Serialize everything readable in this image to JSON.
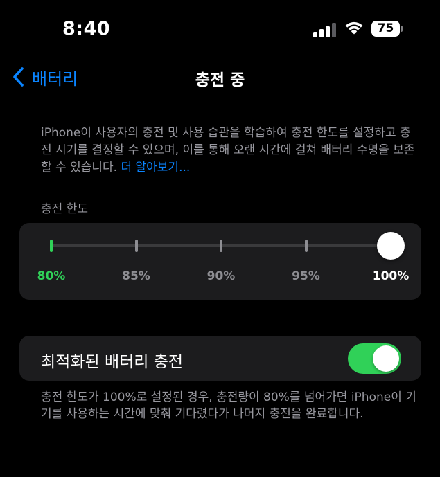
{
  "status_bar": {
    "time": "8:40",
    "battery_level": "75",
    "signal_bars_active": 3,
    "signal_bars_total": 4
  },
  "nav": {
    "back_label": "배터리",
    "title": "충전 중"
  },
  "description": {
    "text": "iPhone이 사용자의 충전 및 사용 습관을 학습하여 충전 한도를 설정하고 충전 시기를 결정할 수 있으며, 이를 통해 오랜 시간에 걸쳐 배터리 수명을 보존할 수 있습니다. ",
    "learn_more": "더 알아보기..."
  },
  "charge_limit": {
    "header": "충전 한도",
    "selected_value": 100,
    "ticks": [
      {
        "label": "80%",
        "value": 80
      },
      {
        "label": "85%",
        "value": 85
      },
      {
        "label": "90%",
        "value": 90
      },
      {
        "label": "95%",
        "value": 95
      },
      {
        "label": "100%",
        "value": 100
      }
    ]
  },
  "optimized_charging": {
    "label": "최적화된 배터리 충전",
    "enabled": true,
    "footer": "충전 한도가 100%로 설정된 경우, 충전량이 80%를 넘어가면 iPhone이 기기를 사용하는 시간에 맞춰 기다렸다가 나머지 충전을 완료합니다."
  },
  "colors": {
    "accent": "#0a84ff",
    "green": "#30d158",
    "background": "#000000",
    "card": "#1c1c1e",
    "secondary_text": "#98989f"
  },
  "icons": {
    "back": "chevron-left-icon",
    "signal": "cellular-signal-icon",
    "wifi": "wifi-icon",
    "battery": "battery-icon"
  }
}
